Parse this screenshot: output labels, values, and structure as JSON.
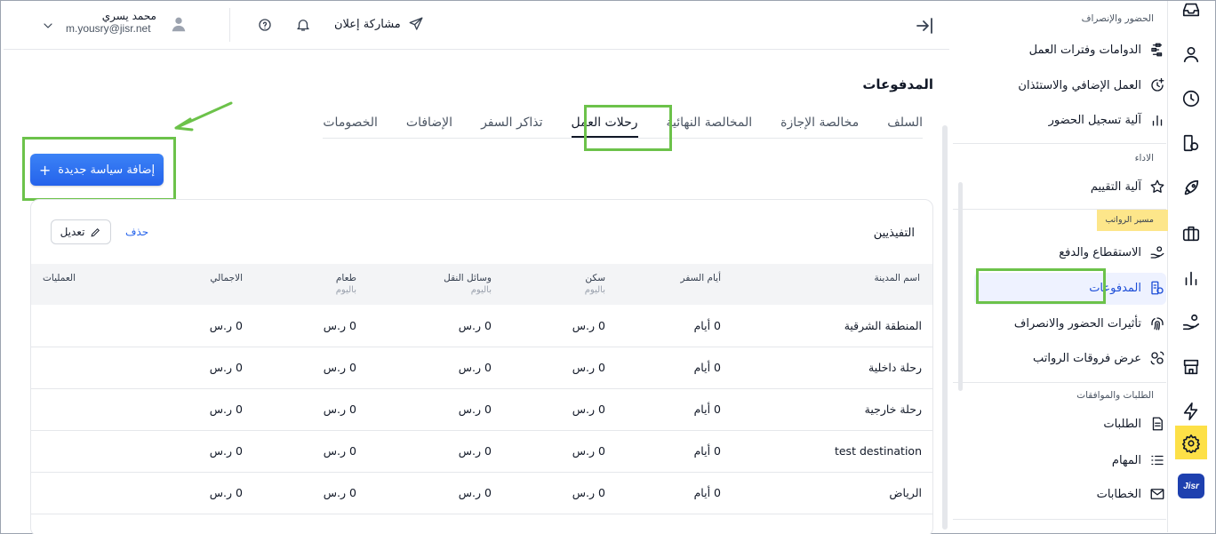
{
  "topbar": {
    "user_name": "محمد يسري",
    "user_email": "m.yousry@jisr.net",
    "share_label": "مشاركة إعلان"
  },
  "page": {
    "title": "المدفوعات",
    "tabs": [
      {
        "label": "السلف",
        "active": false
      },
      {
        "label": "مخالصة الإجازة",
        "active": false
      },
      {
        "label": "المخالصة النهائية",
        "active": false
      },
      {
        "label": "رحلات العمل",
        "active": true
      },
      {
        "label": "تذاكر السفر",
        "active": false
      },
      {
        "label": "الإضافات",
        "active": false
      },
      {
        "label": "الخصومات",
        "active": false
      }
    ],
    "add_button": "إضافة سياسة جديدة"
  },
  "card": {
    "title": "التفيذيين",
    "edit_label": "تعديل",
    "delete_label": "حذف",
    "columns": [
      {
        "label": "اسم المدينة",
        "sub": ""
      },
      {
        "label": "أيام السفر",
        "sub": ""
      },
      {
        "label": "سكن",
        "sub": "باليوم"
      },
      {
        "label": "وسائل النقل",
        "sub": "باليوم"
      },
      {
        "label": "طعام",
        "sub": "باليوم"
      },
      {
        "label": "الاجمالي",
        "sub": ""
      },
      {
        "label": "العمليات",
        "sub": ""
      }
    ],
    "rows": [
      {
        "city": "المنطقة الشرقية",
        "days": "0 أيام",
        "housing": "0 ر.س",
        "transport": "0 ر.س",
        "food": "0 ر.س",
        "total": "0 ر.س"
      },
      {
        "city": "رحلة داخلية",
        "days": "0 أيام",
        "housing": "0 ر.س",
        "transport": "0 ر.س",
        "food": "0 ر.س",
        "total": "0 ر.س"
      },
      {
        "city": "رحلة خارجية",
        "days": "0 أيام",
        "housing": "0 ر.س",
        "transport": "0 ر.س",
        "food": "0 ر.س",
        "total": "0 ر.س"
      },
      {
        "city": "test destination",
        "days": "0 أيام",
        "housing": "0 ر.س",
        "transport": "0 ر.س",
        "food": "0 ر.س",
        "total": "0 ر.س"
      },
      {
        "city": "الرياض",
        "days": "0 أيام",
        "housing": "0 ر.س",
        "transport": "0 ر.س",
        "food": "0 ر.س",
        "total": "0 ر.س"
      }
    ]
  },
  "sidebar": {
    "section_attendance": "الحضور والإنصراف",
    "section_performance": "الاداء",
    "section_payroll": "مسير الرواتب",
    "section_requests": "الطلبات والموافقات",
    "items": {
      "shifts": "الدوامات وفترات العمل",
      "overtime": "العمل الإضافي والاستئذان",
      "attendance_mech": "آلية تسجيل الحضور",
      "evaluation": "آلية التقييم",
      "deductions": "الاستقطاع والدفع",
      "payments": "المدفوعات",
      "attendance_effects": "تأثيرات الحضور والانصراف",
      "salary_diff": "عرض فروقات الرواتب",
      "requests": "الطلبات",
      "tasks": "المهام",
      "letters": "الخطابات"
    }
  },
  "rail": {
    "logo": "Jisr"
  },
  "colors": {
    "accent": "#2563eb",
    "highlight_green": "#6cc24a",
    "highlight_yellow": "#fde047"
  }
}
